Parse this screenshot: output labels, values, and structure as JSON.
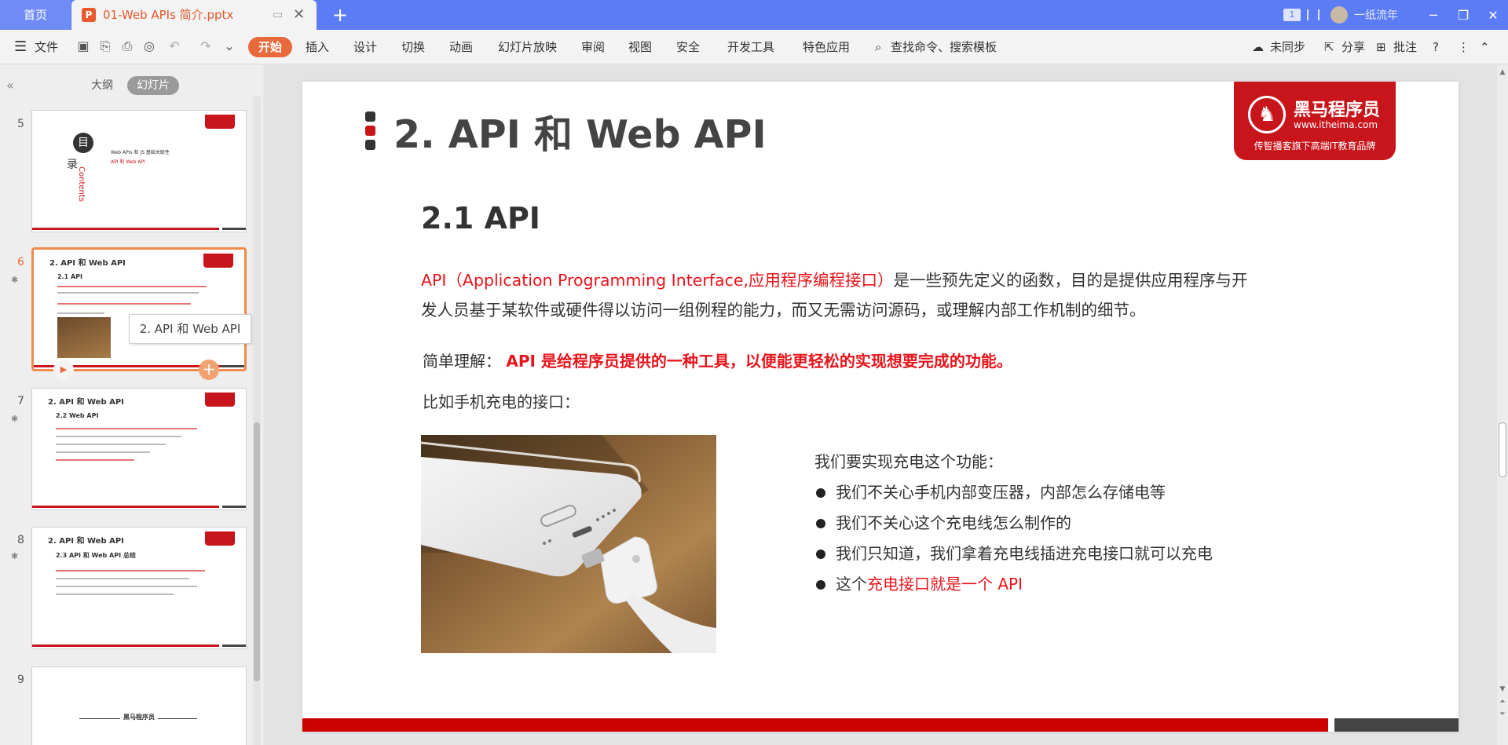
{
  "tabbar": {
    "home_label": "首页",
    "doc_label": "01-Web APIs 简介.pptx",
    "ppt_icon_letter": "P",
    "add_tab": "+",
    "badge": "1",
    "username": "一纸流年"
  },
  "ribbon": {
    "file_label": "文件",
    "menus": [
      "开始",
      "插入",
      "设计",
      "切换",
      "动画",
      "幻灯片放映",
      "审阅",
      "视图",
      "安全",
      "开发工具",
      "特色应用"
    ],
    "search_label": "查找命令、搜索模板",
    "sync_label": "未同步",
    "share_label": "分享",
    "comment_label": "批注"
  },
  "left_panel": {
    "tab_outline": "大纲",
    "tab_slides": "幻灯片",
    "tooltip": "2. API 和 Web API",
    "slides": [
      {
        "num": "5",
        "title": "目录 Contents"
      },
      {
        "num": "6",
        "title": "2. API 和 Web API",
        "sub": "2.1 API"
      },
      {
        "num": "7",
        "title": "2. API 和 Web API",
        "sub": "2.2 Web API"
      },
      {
        "num": "8",
        "title": "2. API 和 Web API",
        "sub": "2.3 API 和 Web API 总结"
      },
      {
        "num": "9",
        "title": "黑马程序员"
      }
    ],
    "thumb5": {
      "char1": "目",
      "char2": "录",
      "contents": "Contents",
      "item1": "Web APIs 和 JS 基础关联性",
      "item2": "API 和 Web API"
    }
  },
  "slide": {
    "title": "2. API 和 Web API",
    "logo_brand": "黑马程序员",
    "logo_url": "www.itheima.com",
    "logo_slogan": "传智播客旗下高端IT教育品牌",
    "subtitle": "2.1 API",
    "para_red": "API（Application Programming Interface,应用程序编程接口）",
    "para_rest": "是一些预先定义的函数，目的是提供应用程序与开发人员基于某软件或硬件得以访问一组例程的能力，而又无需访问源码，或理解内部工作机制的细节。",
    "simple_label": "简单理解：",
    "simple_red": "API 是给程序员提供的一种工具，以便能更轻松的实现想要完成的功能。",
    "example": "比如手机充电的接口：",
    "charge_head": "我们要实现充电这个功能：",
    "bullets": [
      "我们不关心手机内部变压器，内部怎么存储电等",
      "我们不关心这个充电线怎么制作的",
      "我们只知道，我们拿着充电线插进充电接口就可以充电"
    ],
    "bullet4_pre": "这个",
    "bullet4_red": "充电接口就是一个 API"
  },
  "colors": {
    "accent": "#e8693c",
    "tabbar": "#5b7cf4",
    "brand_red": "#c8141b",
    "text_red": "#e8141b"
  }
}
